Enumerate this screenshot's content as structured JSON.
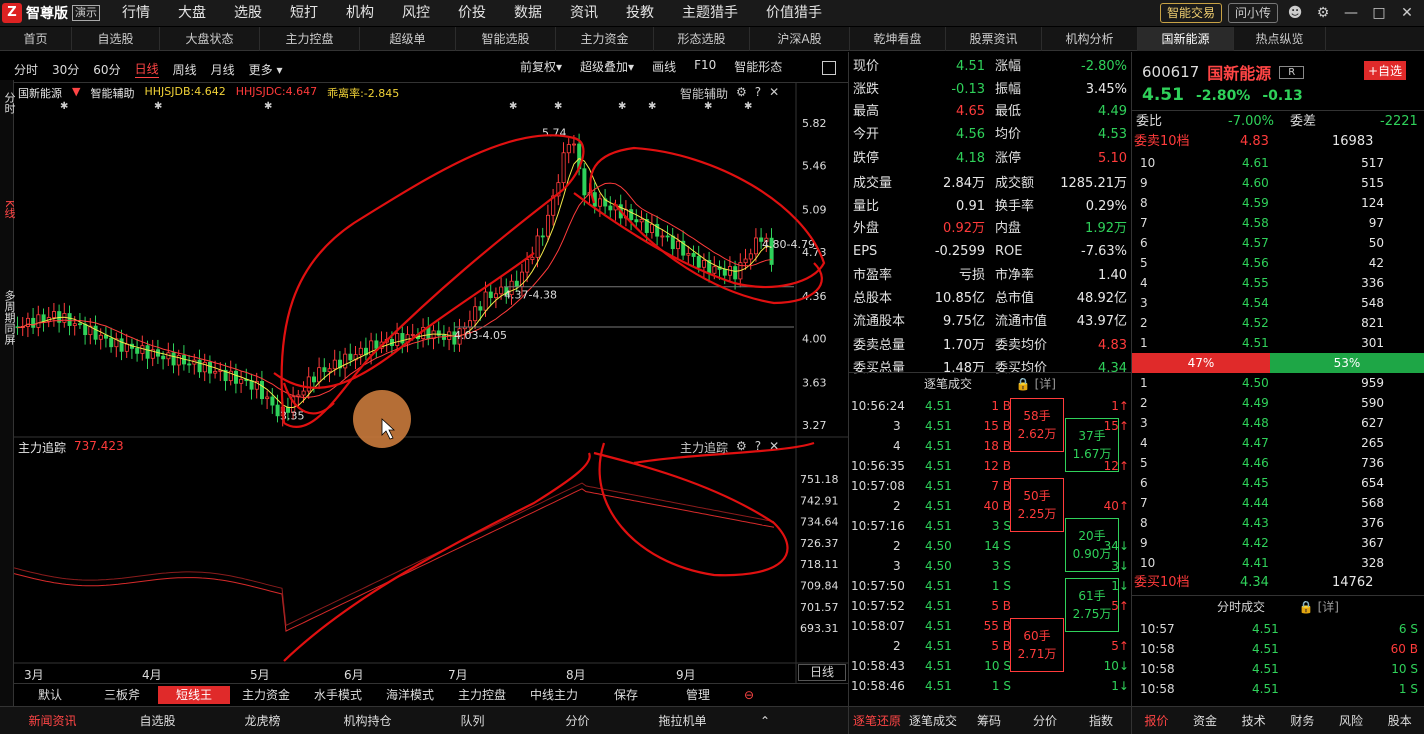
{
  "app": {
    "brand": "智尊版",
    "badge": "演示",
    "menu": [
      "行情",
      "大盘",
      "选股",
      "短打",
      "机构",
      "风控",
      "价投",
      "数据",
      "资讯",
      "投教",
      "主题猎手",
      "价值猎手"
    ],
    "smart_trade": "智能交易",
    "ask": "问小传"
  },
  "tabs": [
    "首页",
    "自选股",
    "大盘状态",
    "主力控盘",
    "超级单",
    "智能选股",
    "主力资金",
    "形态选股",
    "沪深A股",
    "乾坤看盘",
    "股票资讯",
    "机构分析",
    "国新能源",
    "热点纵览"
  ],
  "active_tab": "国新能源",
  "periods": [
    "分时",
    "30分",
    "60分",
    "日线",
    "周线",
    "月线",
    "更多"
  ],
  "active_period": "日线",
  "chart_toolbar": [
    "前复权",
    "超级叠加",
    "画线",
    "F10",
    "智能形态"
  ],
  "left_labels": [
    "分时",
    "K线",
    "多周期同屏"
  ],
  "chart": {
    "stock_name": "国新能源",
    "assist": "智能辅助",
    "ind1": "HHJSJDB:4.642",
    "ind2": "HHJSJDC:4.647",
    "ind3": "乖离率:-2.845",
    "price_ticks": [
      "5.82",
      "5.46",
      "5.09",
      "4.73",
      "4.36",
      "4.00",
      "3.63",
      "3.27"
    ],
    "labels": [
      "5.74",
      "4.80-4.79",
      "4.37-4.38",
      "4.03-4.05",
      "3.35"
    ],
    "sub_title": "主力追踪",
    "sub_value": "737.423",
    "sub_assist": "主力追踪",
    "sub_ticks": [
      "751.18",
      "742.91",
      "734.64",
      "726.37",
      "718.11",
      "709.84",
      "701.57",
      "693.31"
    ],
    "months": [
      "3月",
      "4月",
      "5月",
      "6月",
      "7月",
      "8月",
      "9月"
    ],
    "day_line": "日线"
  },
  "chart_data": {
    "type": "candlestick",
    "x": [
      "3月",
      "4月",
      "5月",
      "6月",
      "7月",
      "8月",
      "9月"
    ],
    "y_range": [
      3.27,
      5.82
    ],
    "series": [
      {
        "name": "K线",
        "values": [
          4.1,
          3.95,
          3.35,
          3.8,
          4.05,
          5.74,
          4.51
        ]
      }
    ]
  },
  "bottom_strategy_tabs": [
    "默认",
    "三板斧",
    "短线王",
    "主力资金",
    "水手模式",
    "海洋模式",
    "主力控盘",
    "中线主力",
    "保存",
    "管理"
  ],
  "active_strategy": "短线王",
  "bottom_nav": [
    "新闻资讯",
    "自选股",
    "龙虎榜",
    "机构持仓",
    "队列",
    "分价",
    "拖拉机单"
  ],
  "quote": {
    "rows": [
      [
        "现价",
        "4.51",
        "涨幅",
        "-2.80%"
      ],
      [
        "涨跌",
        "-0.13",
        "振幅",
        "3.45%"
      ],
      [
        "最高",
        "4.65",
        "最低",
        "4.49"
      ],
      [
        "今开",
        "4.56",
        "均价",
        "4.53"
      ],
      [
        "跌停",
        "4.18",
        "涨停",
        "5.10"
      ],
      [
        "成交量",
        "2.84万",
        "成交额",
        "1285.21万"
      ],
      [
        "量比",
        "0.91",
        "换手率",
        "0.29%"
      ],
      [
        "外盘",
        "0.92万",
        "内盘",
        "1.92万"
      ],
      [
        "EPS",
        "-0.2599",
        "ROE",
        "-7.63%"
      ],
      [
        "市盈率",
        "亏损",
        "市净率",
        "1.40"
      ],
      [
        "总股本",
        "10.85亿",
        "总市值",
        "48.92亿"
      ],
      [
        "流通股本",
        "9.75亿",
        "流通市值",
        "43.97亿"
      ],
      [
        "委卖总量",
        "1.70万",
        "委卖均价",
        "4.83"
      ],
      [
        "委买总量",
        "1.48万",
        "委买均价",
        "4.34"
      ]
    ],
    "trade_title": "逐笔成交",
    "detail": "[详]",
    "trades": [
      [
        "10:56:24",
        "4.51",
        "1B"
      ],
      [
        "3",
        "4.51",
        "15B"
      ],
      [
        "4",
        "4.51",
        "18B"
      ],
      [
        "10:56:35",
        "4.51",
        "12B"
      ],
      [
        "10:57:08",
        "4.51",
        "7B"
      ],
      [
        "2",
        "4.51",
        "40B"
      ],
      [
        "10:57:16",
        "4.51",
        "3S"
      ],
      [
        "2",
        "4.50",
        "14S"
      ],
      [
        "3",
        "4.50",
        "3S"
      ],
      [
        "10:57:50",
        "4.51",
        "1S"
      ],
      [
        "10:57:52",
        "4.51",
        "5B"
      ],
      [
        "10:58:07",
        "4.51",
        "55B"
      ],
      [
        "2",
        "4.51",
        "5B"
      ],
      [
        "10:58:43",
        "4.51",
        "10S"
      ],
      [
        "10:58:46",
        "4.51",
        "1S"
      ]
    ],
    "trade_extra": [
      "1",
      "15",
      "",
      "12",
      "",
      "40",
      "",
      "34",
      "3",
      "1",
      "5",
      "",
      "5",
      "10",
      "1"
    ],
    "bigblocks": [
      {
        "a": "58手",
        "b": "2.62万"
      },
      {
        "a": "37手",
        "b": "1.67万"
      },
      {
        "a": "50手",
        "b": "2.25万"
      },
      {
        "a": "20手",
        "b": "0.90万"
      },
      {
        "a": "61手",
        "b": "2.75万"
      },
      {
        "a": "60手",
        "b": "2.71万"
      }
    ],
    "bottom_tabs": [
      "逐笔还原",
      "逐笔成交",
      "筹码",
      "分价",
      "指数"
    ]
  },
  "book": {
    "code": "600617",
    "name": "国新能源",
    "tag": "R",
    "add": "+自选",
    "price": "4.51",
    "pct": "-2.80%",
    "chg": "-0.13",
    "wb_label": "委比",
    "wb": "-7.00%",
    "wc_label": "委差",
    "wc": "-2221",
    "sell_title": "委卖10档",
    "sell_avg": "4.83",
    "sell_total": "16983",
    "sells": [
      [
        "10",
        "4.61",
        "517"
      ],
      [
        "9",
        "4.60",
        "515"
      ],
      [
        "8",
        "4.59",
        "124"
      ],
      [
        "7",
        "4.58",
        "97"
      ],
      [
        "6",
        "4.57",
        "50"
      ],
      [
        "5",
        "4.56",
        "42"
      ],
      [
        "4",
        "4.55",
        "336"
      ],
      [
        "3",
        "4.54",
        "548"
      ],
      [
        "2",
        "4.52",
        "821"
      ],
      [
        "1",
        "4.51",
        "301"
      ]
    ],
    "ratio_left": "47%",
    "ratio_right": "53%",
    "buys": [
      [
        "1",
        "4.50",
        "959"
      ],
      [
        "2",
        "4.49",
        "590"
      ],
      [
        "3",
        "4.48",
        "627"
      ],
      [
        "4",
        "4.47",
        "265"
      ],
      [
        "5",
        "4.46",
        "736"
      ],
      [
        "6",
        "4.45",
        "654"
      ],
      [
        "7",
        "4.44",
        "568"
      ],
      [
        "8",
        "4.43",
        "376"
      ],
      [
        "9",
        "4.42",
        "367"
      ],
      [
        "10",
        "4.41",
        "328"
      ]
    ],
    "buy_title": "委买10档",
    "buy_avg": "4.34",
    "buy_total": "14762",
    "ticks_title": "分时成交",
    "detail": "[详]",
    "ticks": [
      [
        "10:57",
        "4.51",
        "6 S"
      ],
      [
        "10:58",
        "4.51",
        "60 B"
      ],
      [
        "10:58",
        "4.51",
        "10 S"
      ],
      [
        "10:58",
        "4.51",
        "1 S"
      ]
    ],
    "bottom_tabs": [
      "报价",
      "资金",
      "技术",
      "财务",
      "风险",
      "股本"
    ]
  }
}
